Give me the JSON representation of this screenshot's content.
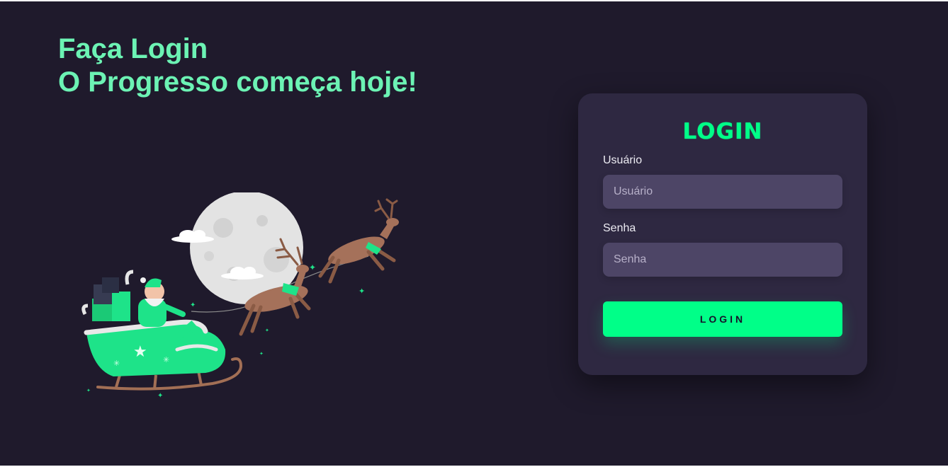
{
  "headline": {
    "line1": "Faça Login",
    "line2": "O Progresso começa hoje!"
  },
  "login_card": {
    "title": "LOGIN",
    "username": {
      "label": "Usuário",
      "placeholder": "Usuário",
      "value": ""
    },
    "password": {
      "label": "Senha",
      "placeholder": "Senha",
      "value": ""
    },
    "submit_label": "LOGIN"
  },
  "colors": {
    "background": "#1f1a2c",
    "card": "#2e2841",
    "input": "#4d4566",
    "accent": "#00ff88",
    "headline": "#6cf3b4"
  },
  "illustration": {
    "subject": "santa-sleigh-with-reindeer-and-moon-illustration"
  }
}
